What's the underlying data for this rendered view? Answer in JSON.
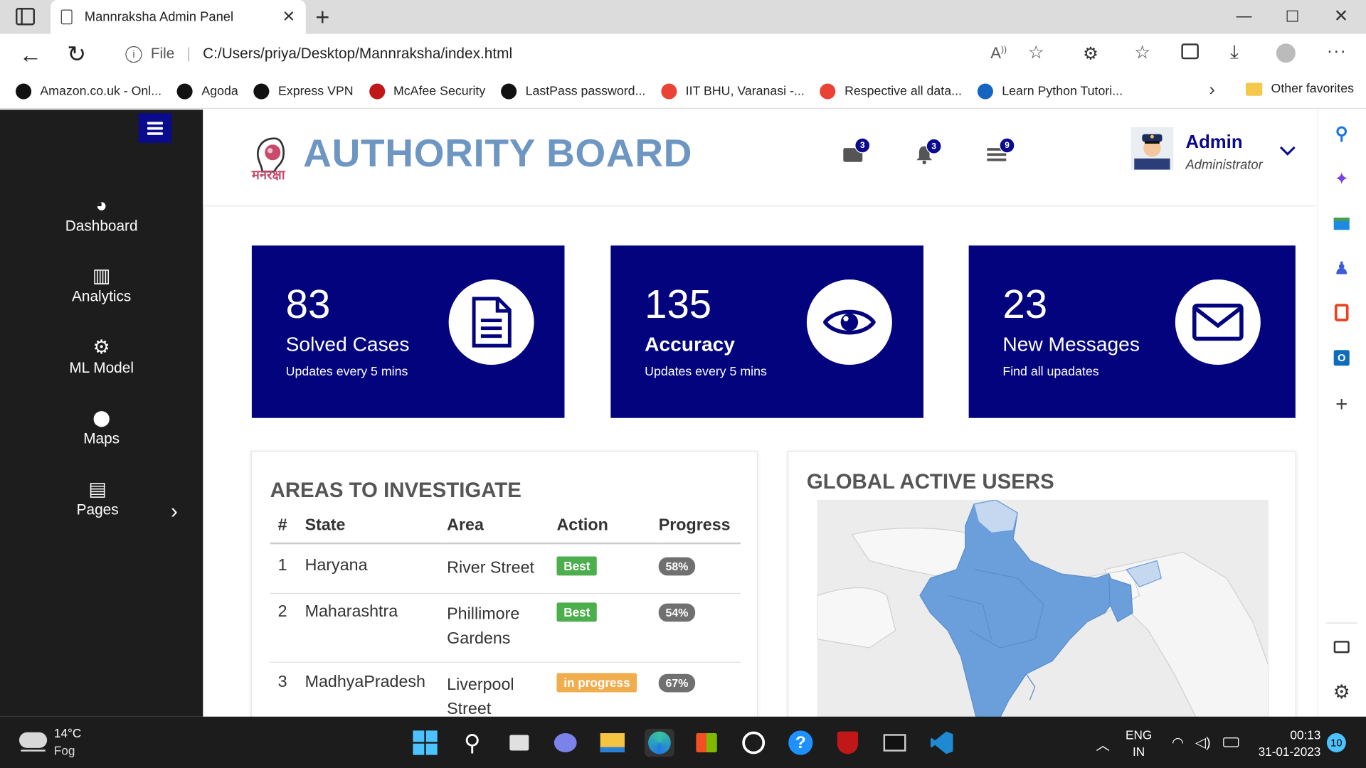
{
  "browser": {
    "tab_title": "Mannraksha Admin Panel",
    "url_prefix": "File",
    "url": "C:/Users/priya/Desktop/Mannraksha/index.html",
    "favorites": [
      {
        "label": "Amazon.co.uk - Onl...",
        "icon": "amazon-icon",
        "color": "#111111"
      },
      {
        "label": "Agoda",
        "icon": "hp-icon",
        "color": "#111111"
      },
      {
        "label": "Express VPN",
        "icon": "hp-icon",
        "color": "#111111"
      },
      {
        "label": "McAfee Security",
        "icon": "mcafee-icon",
        "color": "#c01818"
      },
      {
        "label": "LastPass password...",
        "icon": "hp-icon",
        "color": "#111111"
      },
      {
        "label": "IIT BHU, Varanasi -...",
        "icon": "google-icon",
        "color": "#ea4335"
      },
      {
        "label": "Respective all data...",
        "icon": "google-icon",
        "color": "#ea4335"
      },
      {
        "label": "Learn Python Tutori...",
        "icon": "k-icon",
        "color": "#1565c0"
      }
    ],
    "other_favorites": "Other favorites"
  },
  "sidebar": {
    "items": [
      {
        "label": "Dashboard",
        "icon": "gauge-icon"
      },
      {
        "label": "Analytics",
        "icon": "bar-chart-icon"
      },
      {
        "label": "ML Model",
        "icon": "cogs-icon"
      },
      {
        "label": "Maps",
        "icon": "map-marker-icon"
      },
      {
        "label": "Pages",
        "icon": "pages-icon"
      }
    ]
  },
  "header": {
    "brand": "AUTHORITY BOARD",
    "logo_text": "मनरक्षा",
    "badges": {
      "messages": "3",
      "notifications": "3",
      "tasks": "9"
    },
    "user_name": "Admin",
    "user_role": "Administrator"
  },
  "cards": [
    {
      "number": "83",
      "label": "Solved Cases",
      "sub": "Updates every 5 mins",
      "icon": "document-icon"
    },
    {
      "number": "135",
      "label": "Accuracy",
      "sub": "Updates every 5 mins",
      "icon": "eye-icon"
    },
    {
      "number": "23",
      "label": "New Messages",
      "sub": "Find all upadates",
      "icon": "envelope-icon"
    }
  ],
  "investigate": {
    "title": "AREAS TO INVESTIGATE",
    "columns": [
      "#",
      "State",
      "Area",
      "Action",
      "Progress"
    ],
    "rows": [
      {
        "num": "1",
        "state": "Haryana",
        "area": "River Street",
        "action": "Best",
        "action_color": "#4cae4c",
        "progress": "58%"
      },
      {
        "num": "2",
        "state": "Maharashtra",
        "area": "Phillimore Gardens",
        "action": "Best",
        "action_color": "#4cae4c",
        "progress": "54%"
      },
      {
        "num": "3",
        "state": "MadhyaPradesh",
        "area": "Liverpool Street",
        "action": "in progress",
        "action_color": "#f0ad4e",
        "progress": "67%"
      }
    ]
  },
  "users_panel": {
    "title": "GLOBAL ACTIVE USERS"
  },
  "taskbar": {
    "temperature": "14°C",
    "weather": "Fog",
    "lang_top": "ENG",
    "lang_bottom": "IN",
    "time": "00:13",
    "date": "31-01-2023",
    "notification_count": "10"
  }
}
